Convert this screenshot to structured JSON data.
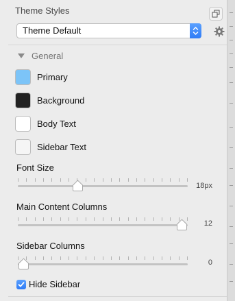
{
  "panel": {
    "title": "Theme Styles",
    "theme_select": {
      "value": "Theme Default"
    }
  },
  "general": {
    "section_label": "General",
    "colors": [
      {
        "label": "Primary",
        "swatch": "#7cc4f8"
      },
      {
        "label": "Background",
        "swatch": "#222222"
      },
      {
        "label": "Body Text",
        "swatch": "#ffffff"
      },
      {
        "label": "Sidebar Text",
        "swatch": "#f5f5f5"
      }
    ]
  },
  "sliders": {
    "font_size": {
      "label": "Font Size",
      "value_text": "18px",
      "position_fraction": 0.34
    },
    "main_columns": {
      "label": "Main Content Columns",
      "value_text": "12",
      "position_fraction": 1.0
    },
    "sidebar_columns": {
      "label": "Sidebar Columns",
      "value_text": "0",
      "position_fraction": 0.0
    }
  },
  "hide_sidebar": {
    "label": "Hide Sidebar",
    "checked": true
  },
  "colors": {
    "accent": "#2f7cf6"
  }
}
